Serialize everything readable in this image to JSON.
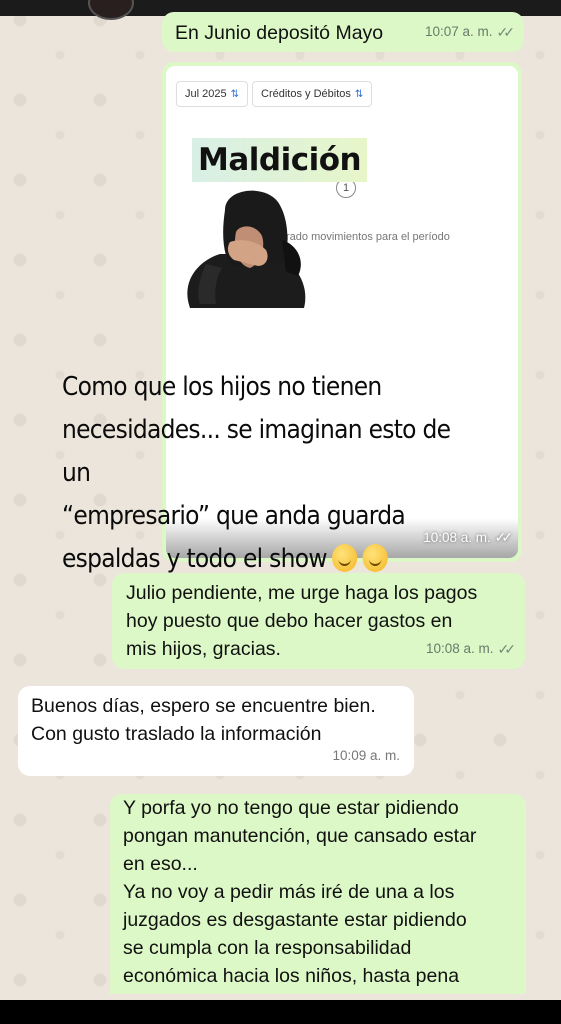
{
  "messages": [
    {
      "text": "En Junio depositó Mayo",
      "time": "10:07 a. m.",
      "ticks": "✓✓"
    },
    {
      "screenshot": {
        "chip_period": "Jul 2025",
        "chip_type": "Créditos y Débitos",
        "chip_sort_glyph": "⇅",
        "info_glyph": "1",
        "empty_text": "rado movimientos para el período",
        "sticker_label": "Maldición"
      },
      "caption_line1": "Como que los hijos no tienen",
      "caption_line2": "necesidades... se imaginan esto de un",
      "caption_line3": "“empresario” que anda guarda",
      "caption_line4": "espaldas y todo el show",
      "time": "10:08 a. m.",
      "ticks": "✓✓"
    },
    {
      "line1": "Julio pendiente, me urge haga los pagos",
      "line2": "hoy puesto que debo hacer gastos en",
      "line3": "mis hijos, gracias.",
      "time": "10:08 a. m.",
      "ticks": "✓✓"
    },
    {
      "line1": "Buenos días, espero se encuentre bien.",
      "line2": "Con gusto traslado la información",
      "time": "10:09 a. m."
    },
    {
      "line1": "Y porfa yo no tengo que estar pidiendo",
      "line2": "pongan manutención, que cansado estar",
      "line3": "en eso...",
      "line4": "Ya no voy a pedir más iré de una a los",
      "line5": "juzgados es desgastante estar pidiendo",
      "line6": "se cumpla con la responsabilidad",
      "line7": "económica hacia los niños, hasta pena"
    }
  ],
  "icons": {
    "forward": "forward-arrow-icon",
    "emoji": "melting-face-emoji"
  },
  "colors": {
    "outgoing": "#dcf8c6",
    "incoming": "#ffffff",
    "wallpaper": "#ece5db"
  }
}
